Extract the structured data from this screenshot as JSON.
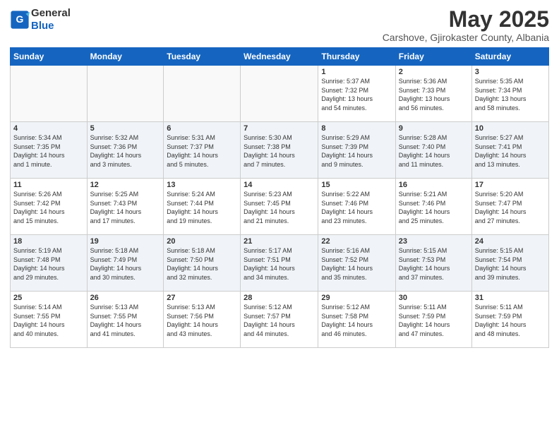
{
  "header": {
    "logo_general": "General",
    "logo_blue": "Blue",
    "month_title": "May 2025",
    "subtitle": "Carshove, Gjirokaster County, Albania"
  },
  "days_of_week": [
    "Sunday",
    "Monday",
    "Tuesday",
    "Wednesday",
    "Thursday",
    "Friday",
    "Saturday"
  ],
  "weeks": [
    [
      {
        "day": "",
        "info": ""
      },
      {
        "day": "",
        "info": ""
      },
      {
        "day": "",
        "info": ""
      },
      {
        "day": "",
        "info": ""
      },
      {
        "day": "1",
        "info": "Sunrise: 5:37 AM\nSunset: 7:32 PM\nDaylight: 13 hours\nand 54 minutes."
      },
      {
        "day": "2",
        "info": "Sunrise: 5:36 AM\nSunset: 7:33 PM\nDaylight: 13 hours\nand 56 minutes."
      },
      {
        "day": "3",
        "info": "Sunrise: 5:35 AM\nSunset: 7:34 PM\nDaylight: 13 hours\nand 58 minutes."
      }
    ],
    [
      {
        "day": "4",
        "info": "Sunrise: 5:34 AM\nSunset: 7:35 PM\nDaylight: 14 hours\nand 1 minute."
      },
      {
        "day": "5",
        "info": "Sunrise: 5:32 AM\nSunset: 7:36 PM\nDaylight: 14 hours\nand 3 minutes."
      },
      {
        "day": "6",
        "info": "Sunrise: 5:31 AM\nSunset: 7:37 PM\nDaylight: 14 hours\nand 5 minutes."
      },
      {
        "day": "7",
        "info": "Sunrise: 5:30 AM\nSunset: 7:38 PM\nDaylight: 14 hours\nand 7 minutes."
      },
      {
        "day": "8",
        "info": "Sunrise: 5:29 AM\nSunset: 7:39 PM\nDaylight: 14 hours\nand 9 minutes."
      },
      {
        "day": "9",
        "info": "Sunrise: 5:28 AM\nSunset: 7:40 PM\nDaylight: 14 hours\nand 11 minutes."
      },
      {
        "day": "10",
        "info": "Sunrise: 5:27 AM\nSunset: 7:41 PM\nDaylight: 14 hours\nand 13 minutes."
      }
    ],
    [
      {
        "day": "11",
        "info": "Sunrise: 5:26 AM\nSunset: 7:42 PM\nDaylight: 14 hours\nand 15 minutes."
      },
      {
        "day": "12",
        "info": "Sunrise: 5:25 AM\nSunset: 7:43 PM\nDaylight: 14 hours\nand 17 minutes."
      },
      {
        "day": "13",
        "info": "Sunrise: 5:24 AM\nSunset: 7:44 PM\nDaylight: 14 hours\nand 19 minutes."
      },
      {
        "day": "14",
        "info": "Sunrise: 5:23 AM\nSunset: 7:45 PM\nDaylight: 14 hours\nand 21 minutes."
      },
      {
        "day": "15",
        "info": "Sunrise: 5:22 AM\nSunset: 7:46 PM\nDaylight: 14 hours\nand 23 minutes."
      },
      {
        "day": "16",
        "info": "Sunrise: 5:21 AM\nSunset: 7:46 PM\nDaylight: 14 hours\nand 25 minutes."
      },
      {
        "day": "17",
        "info": "Sunrise: 5:20 AM\nSunset: 7:47 PM\nDaylight: 14 hours\nand 27 minutes."
      }
    ],
    [
      {
        "day": "18",
        "info": "Sunrise: 5:19 AM\nSunset: 7:48 PM\nDaylight: 14 hours\nand 29 minutes."
      },
      {
        "day": "19",
        "info": "Sunrise: 5:18 AM\nSunset: 7:49 PM\nDaylight: 14 hours\nand 30 minutes."
      },
      {
        "day": "20",
        "info": "Sunrise: 5:18 AM\nSunset: 7:50 PM\nDaylight: 14 hours\nand 32 minutes."
      },
      {
        "day": "21",
        "info": "Sunrise: 5:17 AM\nSunset: 7:51 PM\nDaylight: 14 hours\nand 34 minutes."
      },
      {
        "day": "22",
        "info": "Sunrise: 5:16 AM\nSunset: 7:52 PM\nDaylight: 14 hours\nand 35 minutes."
      },
      {
        "day": "23",
        "info": "Sunrise: 5:15 AM\nSunset: 7:53 PM\nDaylight: 14 hours\nand 37 minutes."
      },
      {
        "day": "24",
        "info": "Sunrise: 5:15 AM\nSunset: 7:54 PM\nDaylight: 14 hours\nand 39 minutes."
      }
    ],
    [
      {
        "day": "25",
        "info": "Sunrise: 5:14 AM\nSunset: 7:55 PM\nDaylight: 14 hours\nand 40 minutes."
      },
      {
        "day": "26",
        "info": "Sunrise: 5:13 AM\nSunset: 7:55 PM\nDaylight: 14 hours\nand 41 minutes."
      },
      {
        "day": "27",
        "info": "Sunrise: 5:13 AM\nSunset: 7:56 PM\nDaylight: 14 hours\nand 43 minutes."
      },
      {
        "day": "28",
        "info": "Sunrise: 5:12 AM\nSunset: 7:57 PM\nDaylight: 14 hours\nand 44 minutes."
      },
      {
        "day": "29",
        "info": "Sunrise: 5:12 AM\nSunset: 7:58 PM\nDaylight: 14 hours\nand 46 minutes."
      },
      {
        "day": "30",
        "info": "Sunrise: 5:11 AM\nSunset: 7:59 PM\nDaylight: 14 hours\nand 47 minutes."
      },
      {
        "day": "31",
        "info": "Sunrise: 5:11 AM\nSunset: 7:59 PM\nDaylight: 14 hours\nand 48 minutes."
      }
    ]
  ]
}
